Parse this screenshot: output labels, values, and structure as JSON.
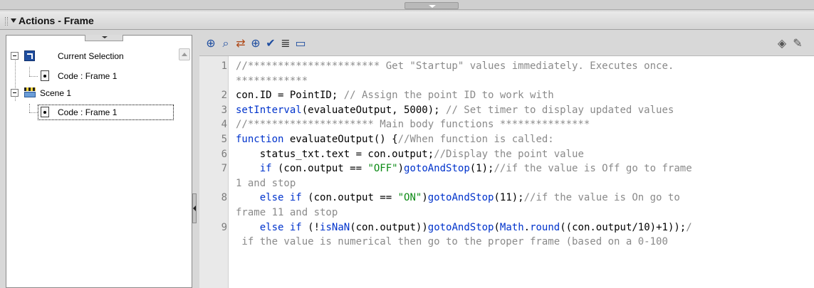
{
  "panel": {
    "title": "Actions - Frame"
  },
  "tree": {
    "items": [
      {
        "label": "Current Selection"
      },
      {
        "label": "Code : Frame 1"
      },
      {
        "label": "Scene 1"
      },
      {
        "label": "Code : Frame 1"
      }
    ]
  },
  "toolbar": {
    "icons": [
      "add-statement-icon",
      "find-icon",
      "replace-icon",
      "insert-target-path-icon",
      "check-syntax-icon",
      "auto-format-icon",
      "show-code-hint-icon",
      "debug-options-icon",
      "script-assist-icon"
    ]
  },
  "code": {
    "lines": [
      {
        "n": "1",
        "segs": [
          {
            "t": "//********************** Get \"Startup\" values immediately. Executes once.",
            "c": "comment"
          }
        ]
      },
      {
        "n": "",
        "segs": [
          {
            "t": "************",
            "c": "comment"
          }
        ]
      },
      {
        "n": "2",
        "segs": [
          {
            "t": "con.ID = PointID; ",
            "c": "id"
          },
          {
            "t": "// Assign the point ID to work with",
            "c": "comment"
          }
        ]
      },
      {
        "n": "3",
        "segs": [
          {
            "t": "setInterval",
            "c": "kw"
          },
          {
            "t": "(evaluateOutput, 5000); ",
            "c": "id"
          },
          {
            "t": "// Set timer to display updated values",
            "c": "comment"
          }
        ]
      },
      {
        "n": "4",
        "segs": [
          {
            "t": "//********************* Main body functions ***************",
            "c": "comment"
          }
        ]
      },
      {
        "n": "5",
        "segs": [
          {
            "t": "function",
            "c": "kw"
          },
          {
            "t": " evaluateOutput() {",
            "c": "id"
          },
          {
            "t": "//When function is called:",
            "c": "comment"
          }
        ]
      },
      {
        "n": "6",
        "segs": [
          {
            "t": "    status_txt.text = con.output;",
            "c": "id"
          },
          {
            "t": "//Display the point value",
            "c": "comment"
          }
        ]
      },
      {
        "n": "7",
        "segs": [
          {
            "t": "    ",
            "c": "id"
          },
          {
            "t": "if",
            "c": "kw"
          },
          {
            "t": " (con.output == ",
            "c": "id"
          },
          {
            "t": "\"OFF\"",
            "c": "str"
          },
          {
            "t": ")",
            "c": "id"
          },
          {
            "t": "gotoAndStop",
            "c": "kw"
          },
          {
            "t": "(1);",
            "c": "id"
          },
          {
            "t": "//if the value is Off go to frame",
            "c": "comment"
          }
        ]
      },
      {
        "n": "",
        "segs": [
          {
            "t": "1 and stop",
            "c": "comment"
          }
        ]
      },
      {
        "n": "8",
        "segs": [
          {
            "t": "    ",
            "c": "id"
          },
          {
            "t": "else if",
            "c": "kw"
          },
          {
            "t": " (con.output == ",
            "c": "id"
          },
          {
            "t": "\"ON\"",
            "c": "str"
          },
          {
            "t": ")",
            "c": "id"
          },
          {
            "t": "gotoAndStop",
            "c": "kw"
          },
          {
            "t": "(11);",
            "c": "id"
          },
          {
            "t": "//if the value is On go to",
            "c": "comment"
          }
        ]
      },
      {
        "n": "",
        "segs": [
          {
            "t": "frame 11 and stop",
            "c": "comment"
          }
        ]
      },
      {
        "n": "9",
        "segs": [
          {
            "t": "    ",
            "c": "id"
          },
          {
            "t": "else if",
            "c": "kw"
          },
          {
            "t": " (!",
            "c": "id"
          },
          {
            "t": "isNaN",
            "c": "kw"
          },
          {
            "t": "(con.output))",
            "c": "id"
          },
          {
            "t": "gotoAndStop",
            "c": "kw"
          },
          {
            "t": "(",
            "c": "id"
          },
          {
            "t": "Math",
            "c": "kw"
          },
          {
            "t": ".",
            "c": "id"
          },
          {
            "t": "round",
            "c": "kw"
          },
          {
            "t": "((con.output/10)+1));",
            "c": "id"
          },
          {
            "t": "/",
            "c": "comment"
          }
        ]
      },
      {
        "n": "",
        "segs": [
          {
            "t": " if the value is numerical then go to the proper frame (based on a 0-100",
            "c": "comment"
          }
        ]
      }
    ]
  },
  "colors": {
    "keyword": "#0033cc",
    "string": "#0b8a14",
    "comment": "#8a8a8a"
  }
}
